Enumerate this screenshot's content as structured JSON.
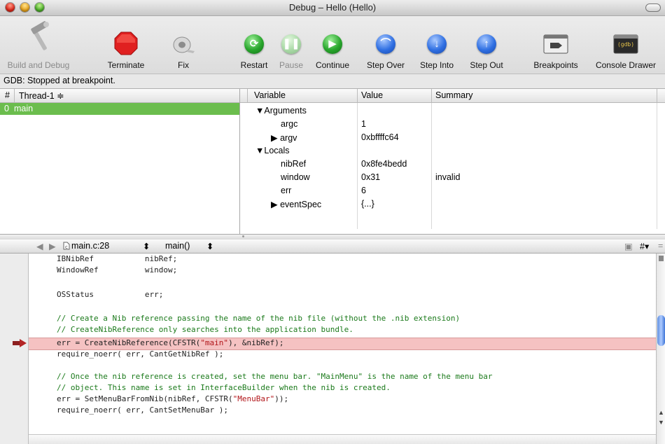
{
  "window": {
    "title": "Debug – Hello (Hello)"
  },
  "toolbar": {
    "build_and_debug": "Build and Debug",
    "terminate": "Terminate",
    "fix": "Fix",
    "restart": "Restart",
    "pause": "Pause",
    "continue": "Continue",
    "step_over": "Step Over",
    "step_into": "Step Into",
    "step_out": "Step Out",
    "breakpoints": "Breakpoints",
    "console_drawer": "Console Drawer",
    "gdb_icon_text": "(gdb)"
  },
  "status": {
    "text": "GDB: Stopped at breakpoint."
  },
  "threads": {
    "col_num": "#",
    "col_thread": "Thread-1 ≑",
    "rows": [
      {
        "num": "0",
        "name": "main"
      }
    ]
  },
  "variables": {
    "columns": {
      "variable": "Variable",
      "value": "Value",
      "summary": "Summary"
    },
    "rows": [
      {
        "name": "▼Arguments",
        "value": "",
        "summary": ""
      },
      {
        "name": "argc",
        "value": "1",
        "summary": ""
      },
      {
        "name": "▶ argv",
        "value": "0xbffffc64",
        "summary": ""
      },
      {
        "name": "▼Locals",
        "value": "",
        "summary": ""
      },
      {
        "name": "nibRef",
        "value": "0x8fe4bedd",
        "summary": ""
      },
      {
        "name": "window",
        "value": "0x31",
        "summary": "invalid"
      },
      {
        "name": "err",
        "value": "6",
        "summary": ""
      },
      {
        "name": "▶ eventSpec",
        "value": "{...}",
        "summary": ""
      }
    ]
  },
  "editor": {
    "file": "main.c:28",
    "function": "main()",
    "lines": [
      {
        "text": "IBNibRef           nibRef;",
        "kind": "code"
      },
      {
        "text": "WindowRef          window;",
        "kind": "code"
      },
      {
        "text": "",
        "kind": "code"
      },
      {
        "text": "OSStatus           err;",
        "kind": "code"
      },
      {
        "text": "",
        "kind": "code"
      },
      {
        "text": "// Create a Nib reference passing the name of the nib file (without the .nib extension)",
        "kind": "comment"
      },
      {
        "text": "// CreateNibReference only searches into the application bundle.",
        "kind": "comment"
      },
      {
        "text": "err = CreateNibReference(CFSTR(\"main\"), &nibRef);",
        "kind": "current"
      },
      {
        "text": "require_noerr( err, CantGetNibRef );",
        "kind": "code"
      },
      {
        "text": "",
        "kind": "code"
      },
      {
        "text": "// Once the nib reference is created, set the menu bar. \"MainMenu\" is the name of the menu bar",
        "kind": "comment"
      },
      {
        "text": "// object. This name is set in InterfaceBuilder when the nib is created.",
        "kind": "comment"
      },
      {
        "text": "err = SetMenuBarFromNib(nibRef, CFSTR(\"MenuBar\"));",
        "kind": "code"
      },
      {
        "text": "require_noerr( err, CantSetMenuBar );",
        "kind": "code"
      }
    ]
  }
}
